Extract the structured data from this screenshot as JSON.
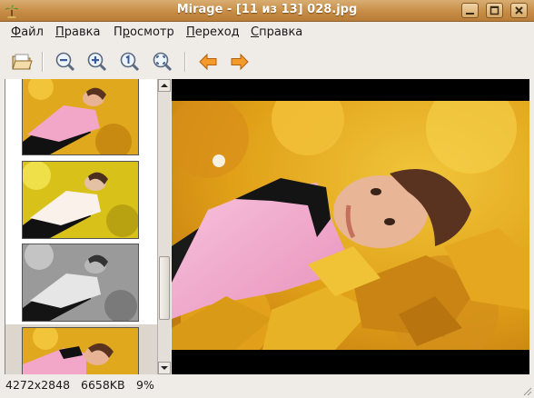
{
  "window": {
    "title": "Mirage - [11 из 13] 028.jpg",
    "accent": "#c68d46"
  },
  "menu": [
    "Файл",
    "Правка",
    "Просмотр",
    "Переход",
    "Справка"
  ],
  "menu_mnemonics": [
    "Ф",
    "П",
    "р",
    "П",
    "С"
  ],
  "toolbar": {
    "icons": [
      "open-folder-icon",
      "zoom-out-icon",
      "zoom-in-icon",
      "zoom-1to1-icon",
      "zoom-fit-icon",
      "back-arrow-icon",
      "forward-arrow-icon"
    ]
  },
  "thumbnails": [
    {
      "variant": "color",
      "selected": false
    },
    {
      "variant": "warm",
      "selected": false
    },
    {
      "variant": "grayscale",
      "selected": false
    },
    {
      "variant": "color",
      "selected": true
    }
  ],
  "status": {
    "resolution": "4272x2848",
    "filesize": "6658KB",
    "zoom": "9%"
  }
}
